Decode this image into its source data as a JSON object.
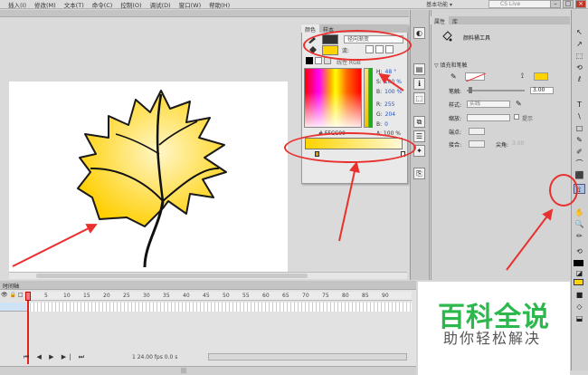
{
  "menubar": {
    "items": [
      "插入(I)",
      "修改(M)",
      "文本(T)",
      "命令(C)",
      "控制(O)",
      "调试(D)",
      "窗口(W)",
      "帮助(H)"
    ],
    "workspace": "基本功能 ▾",
    "search_placeholder": "CS Live"
  },
  "window_controls": {
    "minimize": "–",
    "restore": "□",
    "close": "×"
  },
  "color_panel": {
    "tabs": [
      "颜色",
      "样本"
    ],
    "type": "径向渐变",
    "flow_label": "流:",
    "linear_rgb": "线性 RGB",
    "hsb": [
      {
        "label": "H:",
        "value": "48 °"
      },
      {
        "label": "S:",
        "value": "100 %"
      },
      {
        "label": "B:",
        "value": "100 %"
      },
      {
        "label": "R:",
        "value": "255"
      },
      {
        "label": "G:",
        "value": "204"
      },
      {
        "label": "B:",
        "value": "0"
      }
    ],
    "hex": "# FFCC00",
    "alpha": "A: 100 %",
    "gradient_left": "#ffd400",
    "gradient_right": "#fff9d6"
  },
  "props_panel": {
    "tabs": [
      "属性",
      "库"
    ],
    "tool_name": "颜料桶工具",
    "section": "▽ 填充和笔触",
    "stroke_label": "笔触:",
    "stroke_value": "3.00",
    "style_label": "样式:",
    "style_value": "实线",
    "scale_label": "缩放:",
    "hint_label": "提示",
    "cap_label": "端点:",
    "join_label": "接合:",
    "miter_label": "尖角:",
    "miter_value": "3.00"
  },
  "tools": [
    "↖",
    "↗",
    "⬚",
    "⟲",
    "ℓ",
    "T",
    "\\",
    "□",
    "✎",
    "✐",
    "⌒",
    "⬛",
    "⟟",
    "✋",
    "🔍",
    "✏",
    "⟲",
    "◪",
    "■",
    "◇",
    "⬓"
  ],
  "fill_color": "#ffd400",
  "stroke_color": "#000000",
  "timeline": {
    "tab": "时间轴",
    "frames": [
      "1",
      "5",
      "10",
      "15",
      "20",
      "25",
      "30",
      "35",
      "40",
      "45",
      "50",
      "55",
      "60",
      "65",
      "70",
      "75",
      "80",
      "85",
      "90"
    ],
    "controls": "⏮ ◀ ▶ ▶| ⏭",
    "status": "1   24.00 fps   0.0 s"
  },
  "watermark": {
    "title": "百科全说",
    "subtitle": "助你轻松解决"
  }
}
